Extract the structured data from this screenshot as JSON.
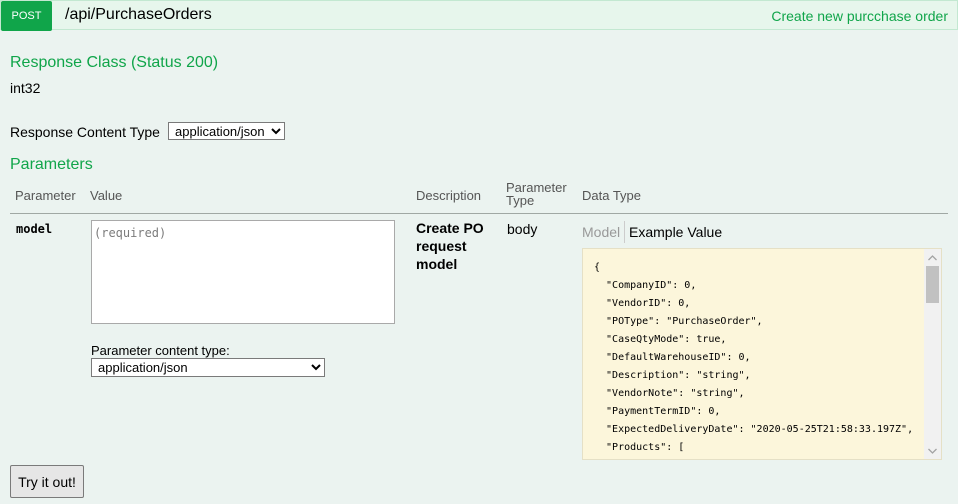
{
  "header": {
    "method": "POST",
    "path": "/api/PurchaseOrders",
    "summary": "Create new purcchase order"
  },
  "response": {
    "class_heading": "Response Class (Status 200)",
    "type": "int32",
    "content_type_label": "Response Content Type",
    "content_type_value": "application/json"
  },
  "parameters": {
    "heading": "Parameters",
    "columns": {
      "parameter": "Parameter",
      "value": "Value",
      "description": "Description",
      "parameter_type_line1": "Parameter",
      "parameter_type_line2": "Type",
      "data_type": "Data Type"
    },
    "rows": [
      {
        "name": "model",
        "placeholder": "(required)",
        "description": "Create PO request model",
        "param_type": "body",
        "content_type_label": "Parameter content type:",
        "content_type_value": "application/json"
      }
    ]
  },
  "data_type": {
    "model_tab": "Model",
    "example_tab": "Example Value",
    "example_json": "{\n  \"CompanyID\": 0,\n  \"VendorID\": 0,\n  \"POType\": \"PurchaseOrder\",\n  \"CaseQtyMode\": true,\n  \"DefaultWarehouseID\": 0,\n  \"Description\": \"string\",\n  \"VendorNote\": \"string\",\n  \"PaymentTermID\": 0,\n  \"ExpectedDeliveryDate\": \"2020-05-25T21:58:33.197Z\",\n  \"Products\": [\n    {"
  },
  "actions": {
    "try_label": "Try it out!"
  },
  "colors": {
    "post_green": "#10a54a",
    "header_bg": "#e7f6ec",
    "page_bg": "#ebf3f0",
    "example_bg": "#fcf6db"
  }
}
